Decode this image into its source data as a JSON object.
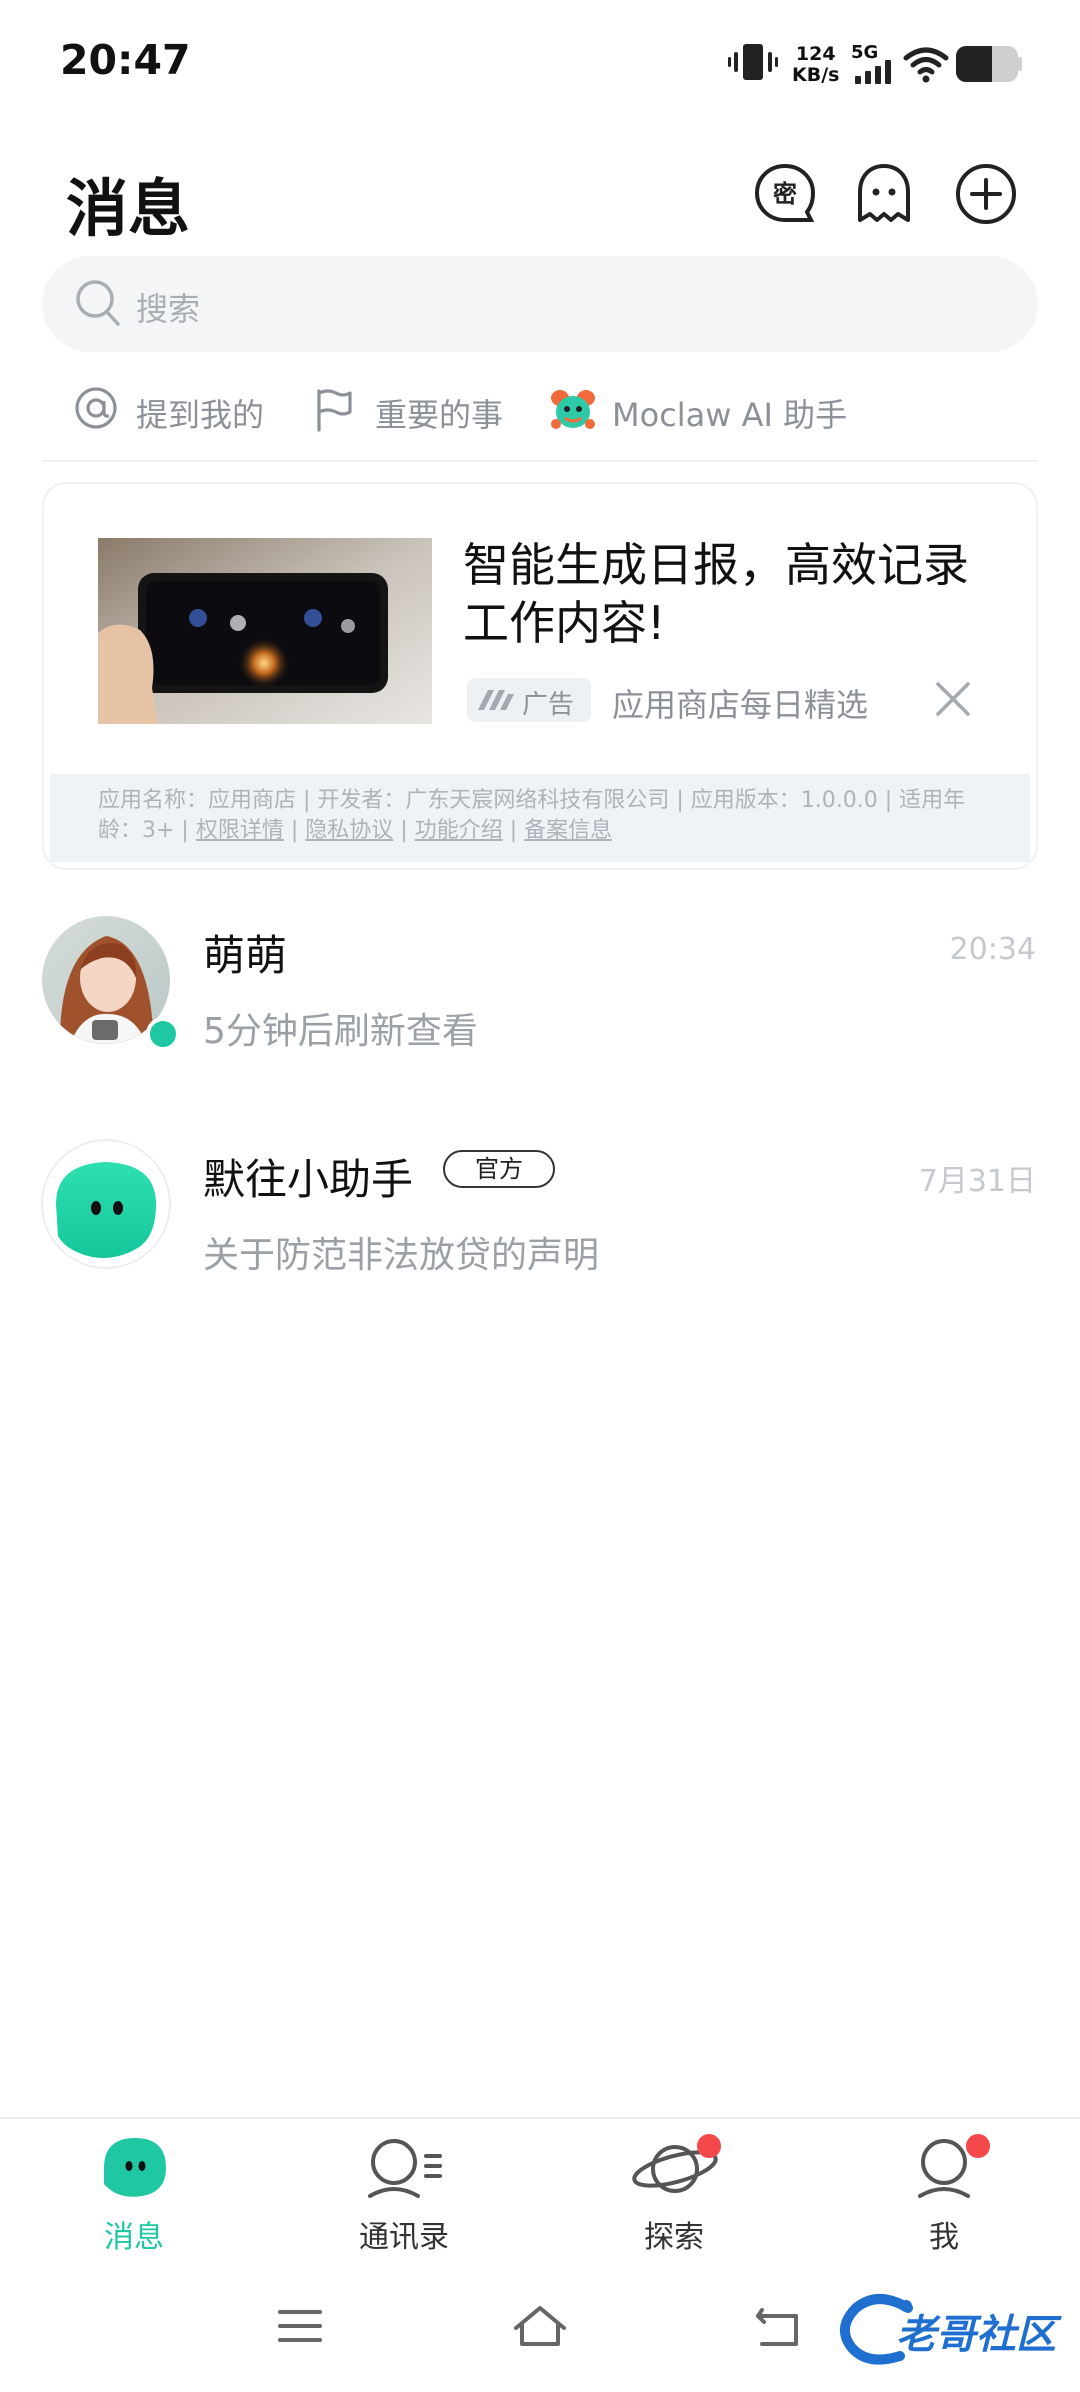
{
  "status_bar": {
    "time": "20:47",
    "net_speed_value": "124",
    "net_speed_unit": "KB/s",
    "network": "5G"
  },
  "header": {
    "title": "消息",
    "icons": [
      "secret-chat-icon",
      "ghost-icon",
      "plus-circle-icon"
    ]
  },
  "search": {
    "placeholder": "搜索"
  },
  "quick_filters": [
    {
      "icon": "at-icon",
      "label": "提到我的"
    },
    {
      "icon": "flag-icon",
      "label": "重要的事"
    },
    {
      "icon": "moclaw-mascot-icon",
      "label": "Moclaw AI 助手"
    }
  ],
  "ad": {
    "title": "智能生成日报，高效记录工作内容!",
    "badge": "广告",
    "source": "应用商店每日精选",
    "info": {
      "text1": "应用名称：应用商店 | 开发者：广东天宸网络科技有限公司 | 应用版本：1.0.0.0 | 适用年龄：3+ | ",
      "links": [
        "权限详情",
        "隐私协议",
        "功能介绍",
        "备案信息"
      ]
    }
  },
  "chats": [
    {
      "name": "萌萌",
      "message": "5分钟后刷新查看",
      "time": "20:34",
      "online": true
    },
    {
      "name": "默往小助手",
      "tag": "官方",
      "message": "关于防范非法放贷的声明",
      "time": "7月31日"
    }
  ],
  "bottom_nav": [
    {
      "label": "消息",
      "active": true
    },
    {
      "label": "通讯录"
    },
    {
      "label": "探索",
      "badge": true
    },
    {
      "label": "我",
      "badge": true
    }
  ],
  "watermark": "老哥社区",
  "colors": {
    "accent": "#1fc7a3",
    "badge": "#f5484a",
    "muted": "#9aa0a6"
  }
}
